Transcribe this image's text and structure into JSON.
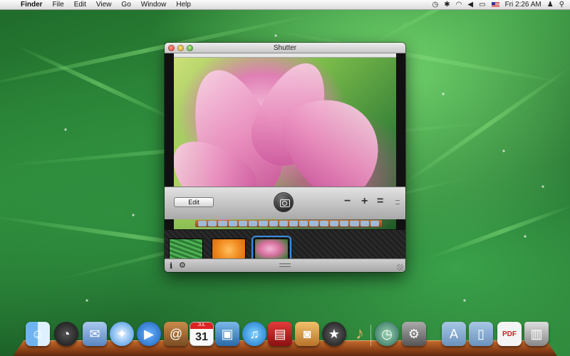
{
  "menubar": {
    "apple": "",
    "app_name": "Finder",
    "items": [
      "File",
      "Edit",
      "View",
      "Go",
      "Window",
      "Help"
    ],
    "clock": "Fri 2:26 AM"
  },
  "window": {
    "title": "Shutter",
    "edit_label": "Edit",
    "minus_label": "−",
    "plus_label": "+",
    "equal_label": "=",
    "info_label": "i",
    "gear_label": "⚙"
  },
  "dock": {
    "calendar_month": "JUL",
    "calendar_day": "31",
    "items": [
      "finder-icon",
      "dashboard-icon",
      "mail-icon",
      "safari-icon",
      "facetime-icon",
      "address-book-icon",
      "ical-icon",
      "iphoto-icon",
      "itunes-icon",
      "photo-booth-icon",
      "image-capture-icon",
      "imovie-icon",
      "garageband-icon",
      "time-machine-icon",
      "system-preferences-icon",
      "applications-folder-icon",
      "documents-folder-icon",
      "pdf-document-icon",
      "trash-icon"
    ]
  },
  "colors": {
    "accent": "#3a8ee6",
    "close": "#e0443a",
    "minimize": "#e0a020",
    "zoom": "#4aa52a"
  }
}
